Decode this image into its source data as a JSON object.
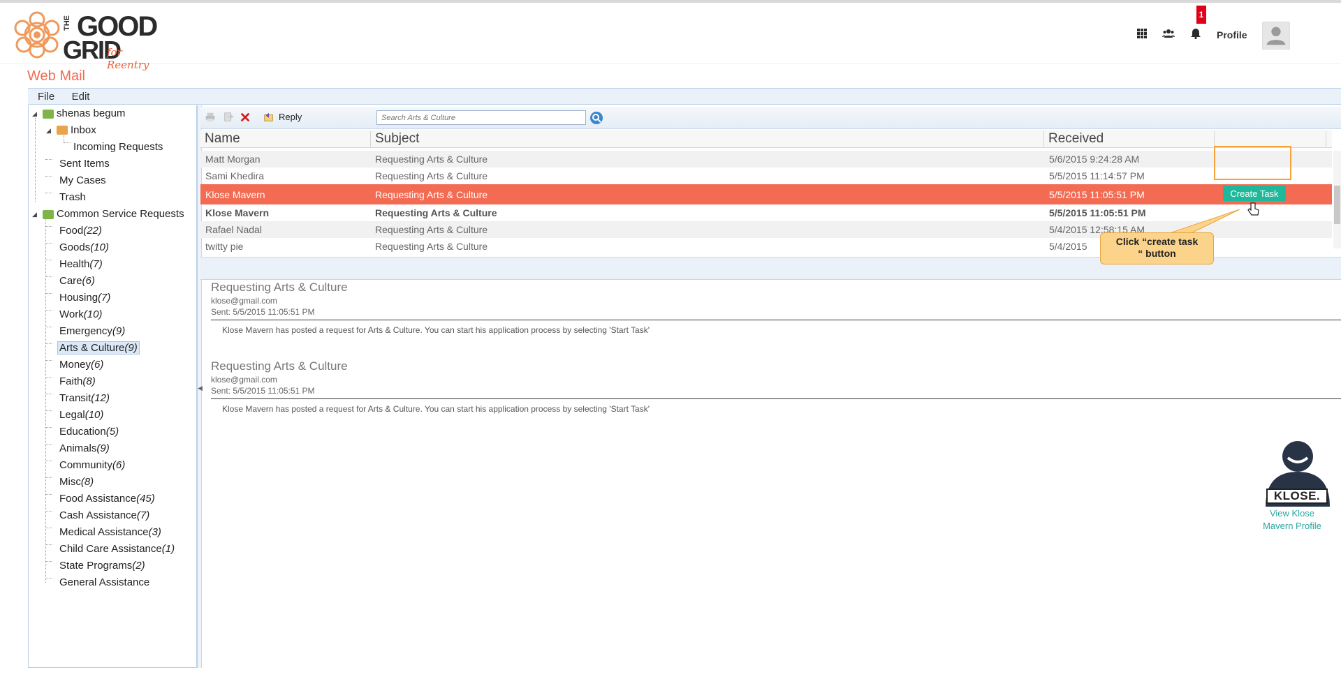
{
  "app": {
    "logo_the": "THE",
    "logo_good": "GOOD",
    "logo_grid": "GRID",
    "logo_tagline": "for Reentry",
    "notification_count": "1",
    "profile_label": "Profile",
    "page_title": "Web Mail",
    "accent_color": "#f26b4f"
  },
  "menu": [
    "File",
    "Edit"
  ],
  "tree": {
    "account": "shenas begum",
    "inbox": "Inbox",
    "incoming": "Incoming Requests",
    "sent": "Sent Items",
    "cases": "My Cases",
    "trash": "Trash",
    "common": "Common Service Requests",
    "categories": [
      {
        "label": "Food",
        "count": "22"
      },
      {
        "label": "Goods",
        "count": "10"
      },
      {
        "label": "Health",
        "count": "7"
      },
      {
        "label": "Care",
        "count": "6"
      },
      {
        "label": "Housing",
        "count": "7"
      },
      {
        "label": "Work",
        "count": "10"
      },
      {
        "label": "Emergency",
        "count": "9"
      },
      {
        "label": "Arts & Culture",
        "count": "9"
      },
      {
        "label": "Money",
        "count": "6"
      },
      {
        "label": "Faith",
        "count": "8"
      },
      {
        "label": "Transit",
        "count": "12"
      },
      {
        "label": "Legal",
        "count": "10"
      },
      {
        "label": "Education",
        "count": "5"
      },
      {
        "label": "Animals",
        "count": "9"
      },
      {
        "label": "Community",
        "count": "6"
      },
      {
        "label": "Misc",
        "count": "8"
      },
      {
        "label": "Food Assistance",
        "count": "45"
      },
      {
        "label": "Cash Assistance",
        "count": "7"
      },
      {
        "label": "Medical Assistance",
        "count": "3"
      },
      {
        "label": "Child Care Assistance",
        "count": "1"
      },
      {
        "label": "State Programs",
        "count": "2"
      },
      {
        "label": "General Assistance",
        "count": ""
      }
    ],
    "selected_category": "Arts & Culture"
  },
  "toolbar": {
    "reply_label": "Reply",
    "search_placeholder": "Search Arts & Culture"
  },
  "grid": {
    "headers": [
      "Name",
      "Subject",
      "Received"
    ],
    "rows": [
      {
        "name": "Matt Morgan",
        "subject": "Requesting Arts & Culture",
        "received": "5/6/2015 9:24:28 AM"
      },
      {
        "name": "Sami Khedira",
        "subject": "Requesting Arts & Culture",
        "received": "5/5/2015 11:14:57 PM"
      },
      {
        "name": "Klose Mavern",
        "subject": "Requesting Arts & Culture",
        "received": "5/5/2015 11:05:51 PM"
      },
      {
        "name": "Klose Mavern",
        "subject": "Requesting Arts & Culture",
        "received": "5/5/2015 11:05:51 PM"
      },
      {
        "name": "Rafael Nadal",
        "subject": "Requesting Arts & Culture",
        "received": "5/4/2015 12:58:15 AM"
      },
      {
        "name": "twitty pie",
        "subject": "Requesting Arts & Culture",
        "received": "5/4/2015"
      }
    ],
    "create_task_label": "Create Task"
  },
  "messages": [
    {
      "subject": "Requesting Arts & Culture",
      "from": "klose@gmail.com",
      "sent": "Sent: 5/5/2015 11:05:51 PM",
      "body": "Klose Mavern has posted a request for Arts & Culture. You can start his application process by selecting 'Start Task'"
    },
    {
      "subject": "Requesting Arts & Culture",
      "from": "klose@gmail.com",
      "sent": "Sent: 5/5/2015 11:05:51 PM",
      "body": "Klose Mavern has posted a request for Arts & Culture. You can start his application process by selecting 'Start Task'"
    }
  ],
  "callout": {
    "line1": "Click “create task",
    "line2": "“ button"
  },
  "profile_card": {
    "badge": "KLOSE.",
    "link_line1": "View Klose",
    "link_line2": "Mavern Profile"
  }
}
